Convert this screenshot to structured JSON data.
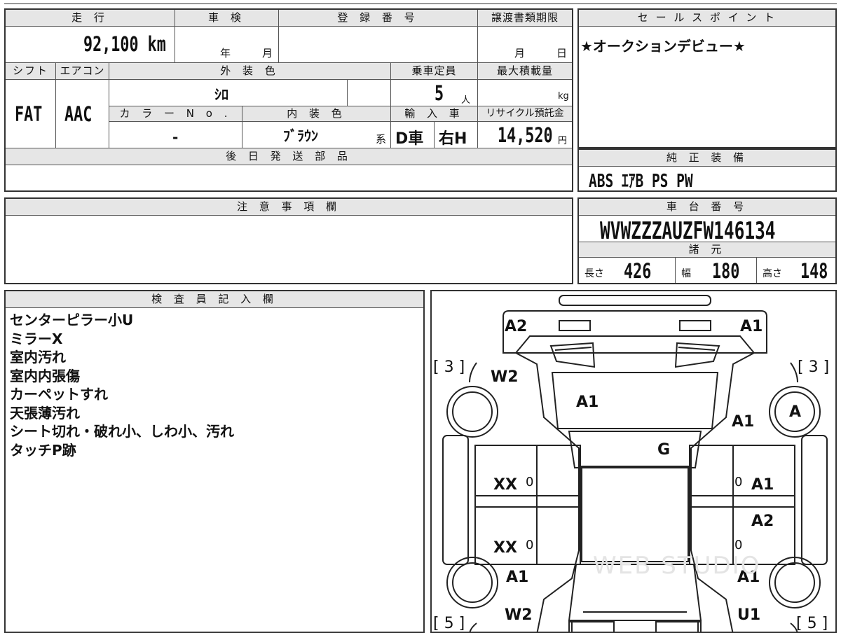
{
  "mileage": {
    "header": "走 行",
    "value": "92,100 km"
  },
  "inspection": {
    "header": "車 検",
    "year_label": "年",
    "month_label": "月"
  },
  "registration": {
    "header": "登 録 番 号",
    "value": ""
  },
  "transfer_deadline": {
    "header": "譲渡書類期限",
    "month_label": "月",
    "day_label": "日"
  },
  "sales_point": {
    "header": "セ ー ル ス ポ イ ン ト",
    "text": "★オークションデビュー★"
  },
  "shift": {
    "header": "シフト",
    "value": "FAT"
  },
  "aircon": {
    "header": "エアコン",
    "value": "AAC"
  },
  "exterior_color": {
    "header": "外 装 色",
    "value": "ｼﾛ"
  },
  "capacity": {
    "header": "乗車定員",
    "value": "5",
    "unit": "人"
  },
  "max_load": {
    "header": "最大積載量",
    "value": "",
    "unit": "kg"
  },
  "color_no": {
    "header": "カ ラ ー N o .",
    "value": "-"
  },
  "interior_color": {
    "header": "内 装 色",
    "value": "ﾌﾞﾗｳﾝ",
    "suffix": "系"
  },
  "import": {
    "header": "輸 入 車",
    "type": "D車",
    "steering": "右H"
  },
  "recycle_deposit": {
    "header": "リサイクル預託金",
    "value": "14,520",
    "unit": "円"
  },
  "later_parts": {
    "header": "後 日 発 送 部 品",
    "value": ""
  },
  "genuine_equipment": {
    "header": "純 正 装 備",
    "value": "ABS ｴｱB PS PW"
  },
  "notes_field": {
    "header": "注 意 事 項 欄",
    "value": ""
  },
  "chassis_number": {
    "header": "車 台 番 号",
    "value": "WVWZZZAUZFW146134"
  },
  "specs": {
    "header": "諸 元",
    "length_label": "長さ",
    "length": "426",
    "width_label": "幅",
    "width": "180",
    "height_label": "高さ",
    "height": "148"
  },
  "inspector_notes": {
    "header": "検 査 員 記 入 欄",
    "lines": [
      "センターピラー小U",
      "ミラーX",
      "室内汚れ",
      "室内内張傷",
      "カーペットすれ",
      "天張薄汚れ",
      "シート切れ・破れ小、しわ小、汚れ",
      "タッチP跡"
    ]
  },
  "damage_map": {
    "front_left_lamp": "A2",
    "front_right_lamp": "A1",
    "front_left_tire": "[ 3 ]",
    "front_right_tire": "[ 3 ]",
    "front_left_fender": "W2",
    "windshield": "A1",
    "front_right_fender": "A1",
    "front_right_wheel": "A",
    "roof": "G",
    "front_left_door": "XX",
    "front_left_door_code": "0",
    "front_right_door": "A1",
    "front_right_door_code": "0",
    "rear_left_door": "XX",
    "rear_left_door_code": "0",
    "rear_right_door": "A2",
    "rear_right_door_code": "0",
    "rear_left_quarter": "A1",
    "rear_right_quarter": "A1",
    "rear_left_bottom": "W2",
    "rear_right_bottom": "U1",
    "rear_left_tire": "[ 5 ]",
    "rear_right_tire": "[ 5 ]"
  },
  "watermark": "WEB STUDIO"
}
